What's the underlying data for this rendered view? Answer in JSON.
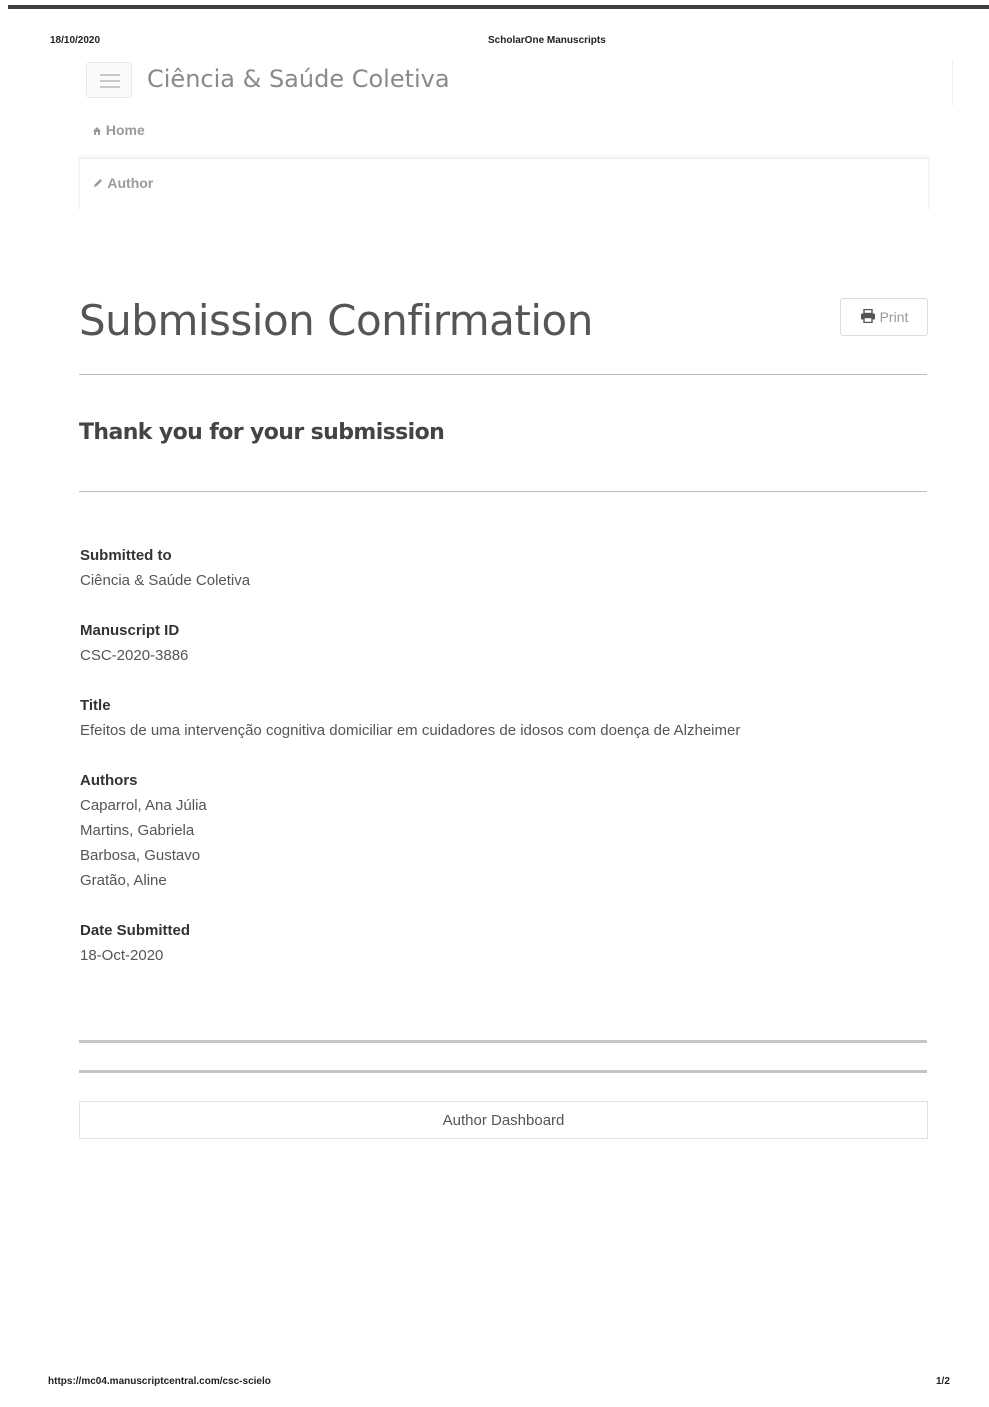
{
  "print_header": {
    "date": "18/10/2020",
    "title": "ScholarOne Manuscripts"
  },
  "header": {
    "menu_icon": "hamburger-menu-icon",
    "brand": "Ciência & Saúde Coletiva"
  },
  "nav": {
    "home_icon": "home-icon",
    "home_label": "Home",
    "author_icon": "pencil-icon",
    "author_label": "Author"
  },
  "main": {
    "title": "Submission Confirmation",
    "print_icon": "printer-icon",
    "print_label": "Print",
    "subtitle": "Thank you for your submission",
    "details": {
      "submitted_to_label": "Submitted to",
      "submitted_to": "Ciência & Saúde Coletiva",
      "manuscript_id_label": "Manuscript ID",
      "manuscript_id": "CSC-2020-3886",
      "title_label": "Title",
      "title": "Efeitos de uma intervenção cognitiva domiciliar em cuidadores de idosos com doença de Alzheimer",
      "authors_label": "Authors",
      "authors": [
        "Caparrol, Ana Júlia",
        "Martins, Gabriela",
        "Barbosa, Gustavo",
        "Gratão, Aline"
      ],
      "date_label": "Date Submitted",
      "date": "18-Oct-2020"
    },
    "dashboard_label": "Author Dashboard"
  },
  "print_footer": {
    "url": "https://mc04.manuscriptcentral.com/csc-scielo",
    "page": "1/2"
  },
  "colors": {
    "text": "#555555",
    "label": "#333333",
    "muted": "#9a9a9a",
    "rule": "#bdbdbd"
  }
}
